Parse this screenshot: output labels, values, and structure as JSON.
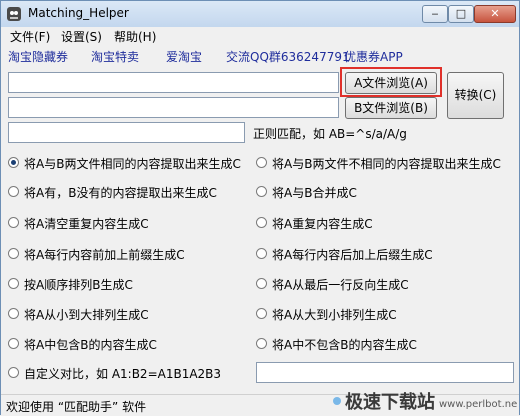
{
  "window": {
    "title": "Matching_Helper",
    "min": "‒",
    "max": "□",
    "close": "✕"
  },
  "menu": [
    "文件(F)",
    "设置(S)",
    "帮助(H)"
  ],
  "links": [
    "淘宝隐藏券",
    "淘宝特卖",
    "爱淘宝",
    "交流QQ群636247791",
    "优惠券APP"
  ],
  "inputs": {
    "a_path": "",
    "b_path": "",
    "regex": "",
    "custom": ""
  },
  "buttons": {
    "browse_a": "A文件浏览(A)",
    "browse_b": "B文件浏览(B)",
    "convert": "转换(C)"
  },
  "regex_label": "正则匹配，如 AB=^s/a/A/g",
  "options": [
    {
      "label": "将A与B两文件相同的内容提取出来生成C",
      "checked": true
    },
    {
      "label": "将A与B两文件不相同的内容提取出来生成C",
      "checked": false
    },
    {
      "label": "将A有，B没有的内容提取出来生成C",
      "checked": false
    },
    {
      "label": "将A与B合并成C",
      "checked": false
    },
    {
      "label": "将A清空重复内容生成C",
      "checked": false
    },
    {
      "label": "将A重复内容生成C",
      "checked": false
    },
    {
      "label": "将A每行内容前加上前缀生成C",
      "checked": false
    },
    {
      "label": "将A每行内容后加上后缀生成C",
      "checked": false
    },
    {
      "label": "按A顺序排列B生成C",
      "checked": false
    },
    {
      "label": "将A从最后一行反向生成C",
      "checked": false
    },
    {
      "label": "将A从小到大排列生成C",
      "checked": false
    },
    {
      "label": "将A从大到小排列生成C",
      "checked": false
    },
    {
      "label": "将A中包含B的内容生成C",
      "checked": false
    },
    {
      "label": "将A中不包含B的内容生成C",
      "checked": false
    },
    {
      "label": "自定义对比，如 A1:B2=A1B1A2B3",
      "checked": false
    }
  ],
  "status": "欢迎使用 “匹配助手” 软件",
  "watermark": {
    "text": "极速下载站",
    "url": "www.perlbot.net"
  },
  "colors": {
    "accent": "#1f2d9c",
    "highlight": "#e0302a"
  }
}
